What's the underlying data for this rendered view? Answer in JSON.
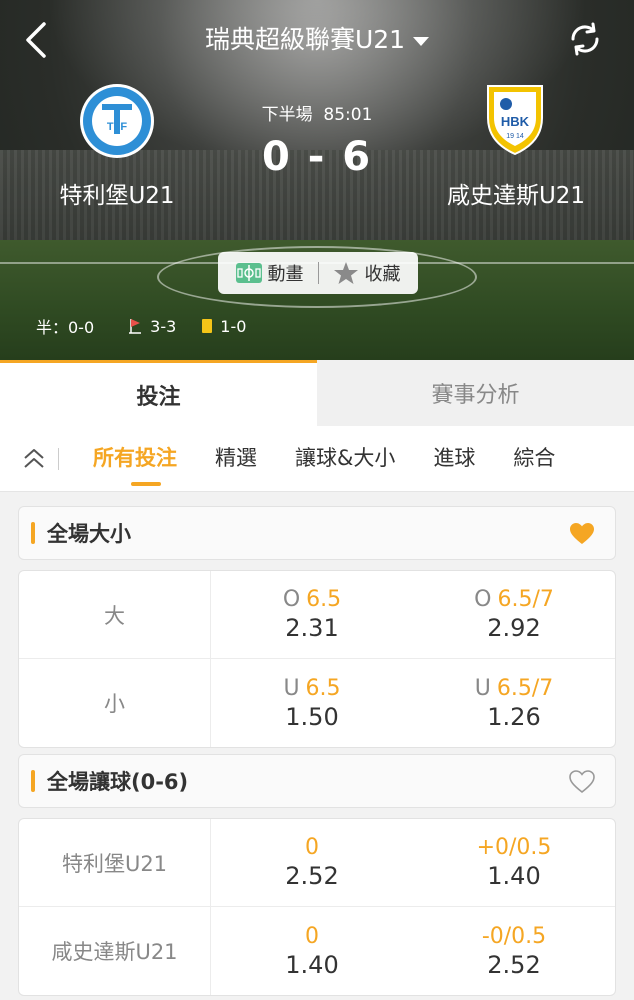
{
  "header": {
    "title": "瑞典超級聯賽U21",
    "home": {
      "name": "特利堡U21",
      "logo_text": "TFF",
      "logo_ring": "TRELLEBORGS FF"
    },
    "away": {
      "name": "咸史達斯U21",
      "logo_text": "HBK",
      "logo_year": "19 14"
    },
    "period": "下半場",
    "clock": "85:01",
    "score": "0 - 6",
    "actions": {
      "animation": "動畫",
      "favorite": "收藏"
    },
    "stats": {
      "half": "半：0-0",
      "corners": "3-3",
      "yellow": "1-0"
    },
    "icons": {
      "back": "back-arrow-icon",
      "refresh": "refresh-icon",
      "caret": "caret-down-icon"
    }
  },
  "tabs": [
    {
      "label": "投注",
      "active": true
    },
    {
      "label": "賽事分析",
      "active": false
    }
  ],
  "subnav": [
    "所有投注",
    "精選",
    "讓球&大小",
    "進球",
    "綜合"
  ],
  "sections": [
    {
      "title": "全場大小",
      "favorited": true,
      "rows": [
        {
          "label": "大",
          "cells": [
            {
              "prefix": "O",
              "line": "6.5",
              "odds": "2.31"
            },
            {
              "prefix": "O",
              "line": "6.5/7",
              "odds": "2.92"
            }
          ]
        },
        {
          "label": "小",
          "cells": [
            {
              "prefix": "U",
              "line": "6.5",
              "odds": "1.50"
            },
            {
              "prefix": "U",
              "line": "6.5/7",
              "odds": "1.26"
            }
          ]
        }
      ]
    },
    {
      "title": "全場讓球(0-6)",
      "favorited": false,
      "rows": [
        {
          "label": "特利堡U21",
          "cells": [
            {
              "prefix": "",
              "line": "0",
              "odds": "2.52"
            },
            {
              "prefix": "",
              "line": "+0/0.5",
              "odds": "1.40"
            }
          ]
        },
        {
          "label": "咸史達斯U21",
          "cells": [
            {
              "prefix": "",
              "line": "0",
              "odds": "1.40"
            },
            {
              "prefix": "",
              "line": "-0/0.5",
              "odds": "2.52"
            }
          ]
        }
      ]
    }
  ],
  "colors": {
    "accent": "#f5a623",
    "text": "#333333",
    "muted": "#888888"
  }
}
